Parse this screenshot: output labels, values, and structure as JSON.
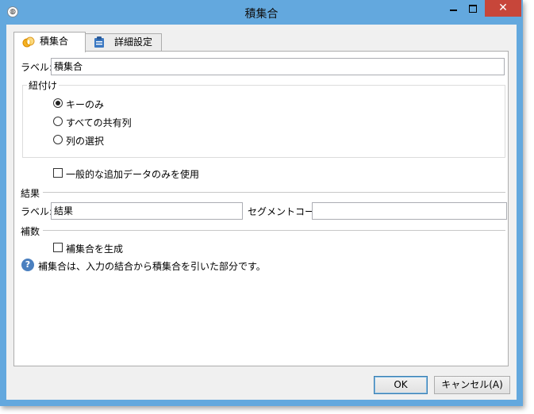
{
  "window": {
    "title": "積集合",
    "close_glyph": "✕",
    "app_icon_glyph": "◍"
  },
  "tabs": [
    {
      "label": "積集合",
      "active": true,
      "icon": "venn-icon"
    },
    {
      "label": "詳細設定",
      "active": false,
      "icon": "clipboard-icon"
    }
  ],
  "label_field": {
    "label": "ラベル:",
    "value": "積集合"
  },
  "join_group": {
    "title": "紐付け",
    "options": [
      {
        "label": "キーのみ",
        "selected": true
      },
      {
        "label": "すべての共有列",
        "selected": false
      },
      {
        "label": "列の選択",
        "selected": false
      }
    ]
  },
  "common_data_checkbox": {
    "label": "一般的な追加データのみを使用",
    "checked": false
  },
  "result_section": {
    "title": "結果",
    "label_label": "ラベル:",
    "label_value": "結果",
    "segment_label": "セグメントコード:",
    "segment_value": ""
  },
  "complement_section": {
    "title": "補数",
    "checkbox_label": "補集合を生成",
    "checked": false
  },
  "help": {
    "glyph": "?",
    "text": "補集合は、入力の結合から積集合を引いた部分です。"
  },
  "buttons": {
    "ok": "OK",
    "cancel": "キャンセル(A)"
  },
  "colors": {
    "frame": "#63a8de",
    "close": "#c7463a",
    "dialog_bg": "#f0f0f0"
  }
}
